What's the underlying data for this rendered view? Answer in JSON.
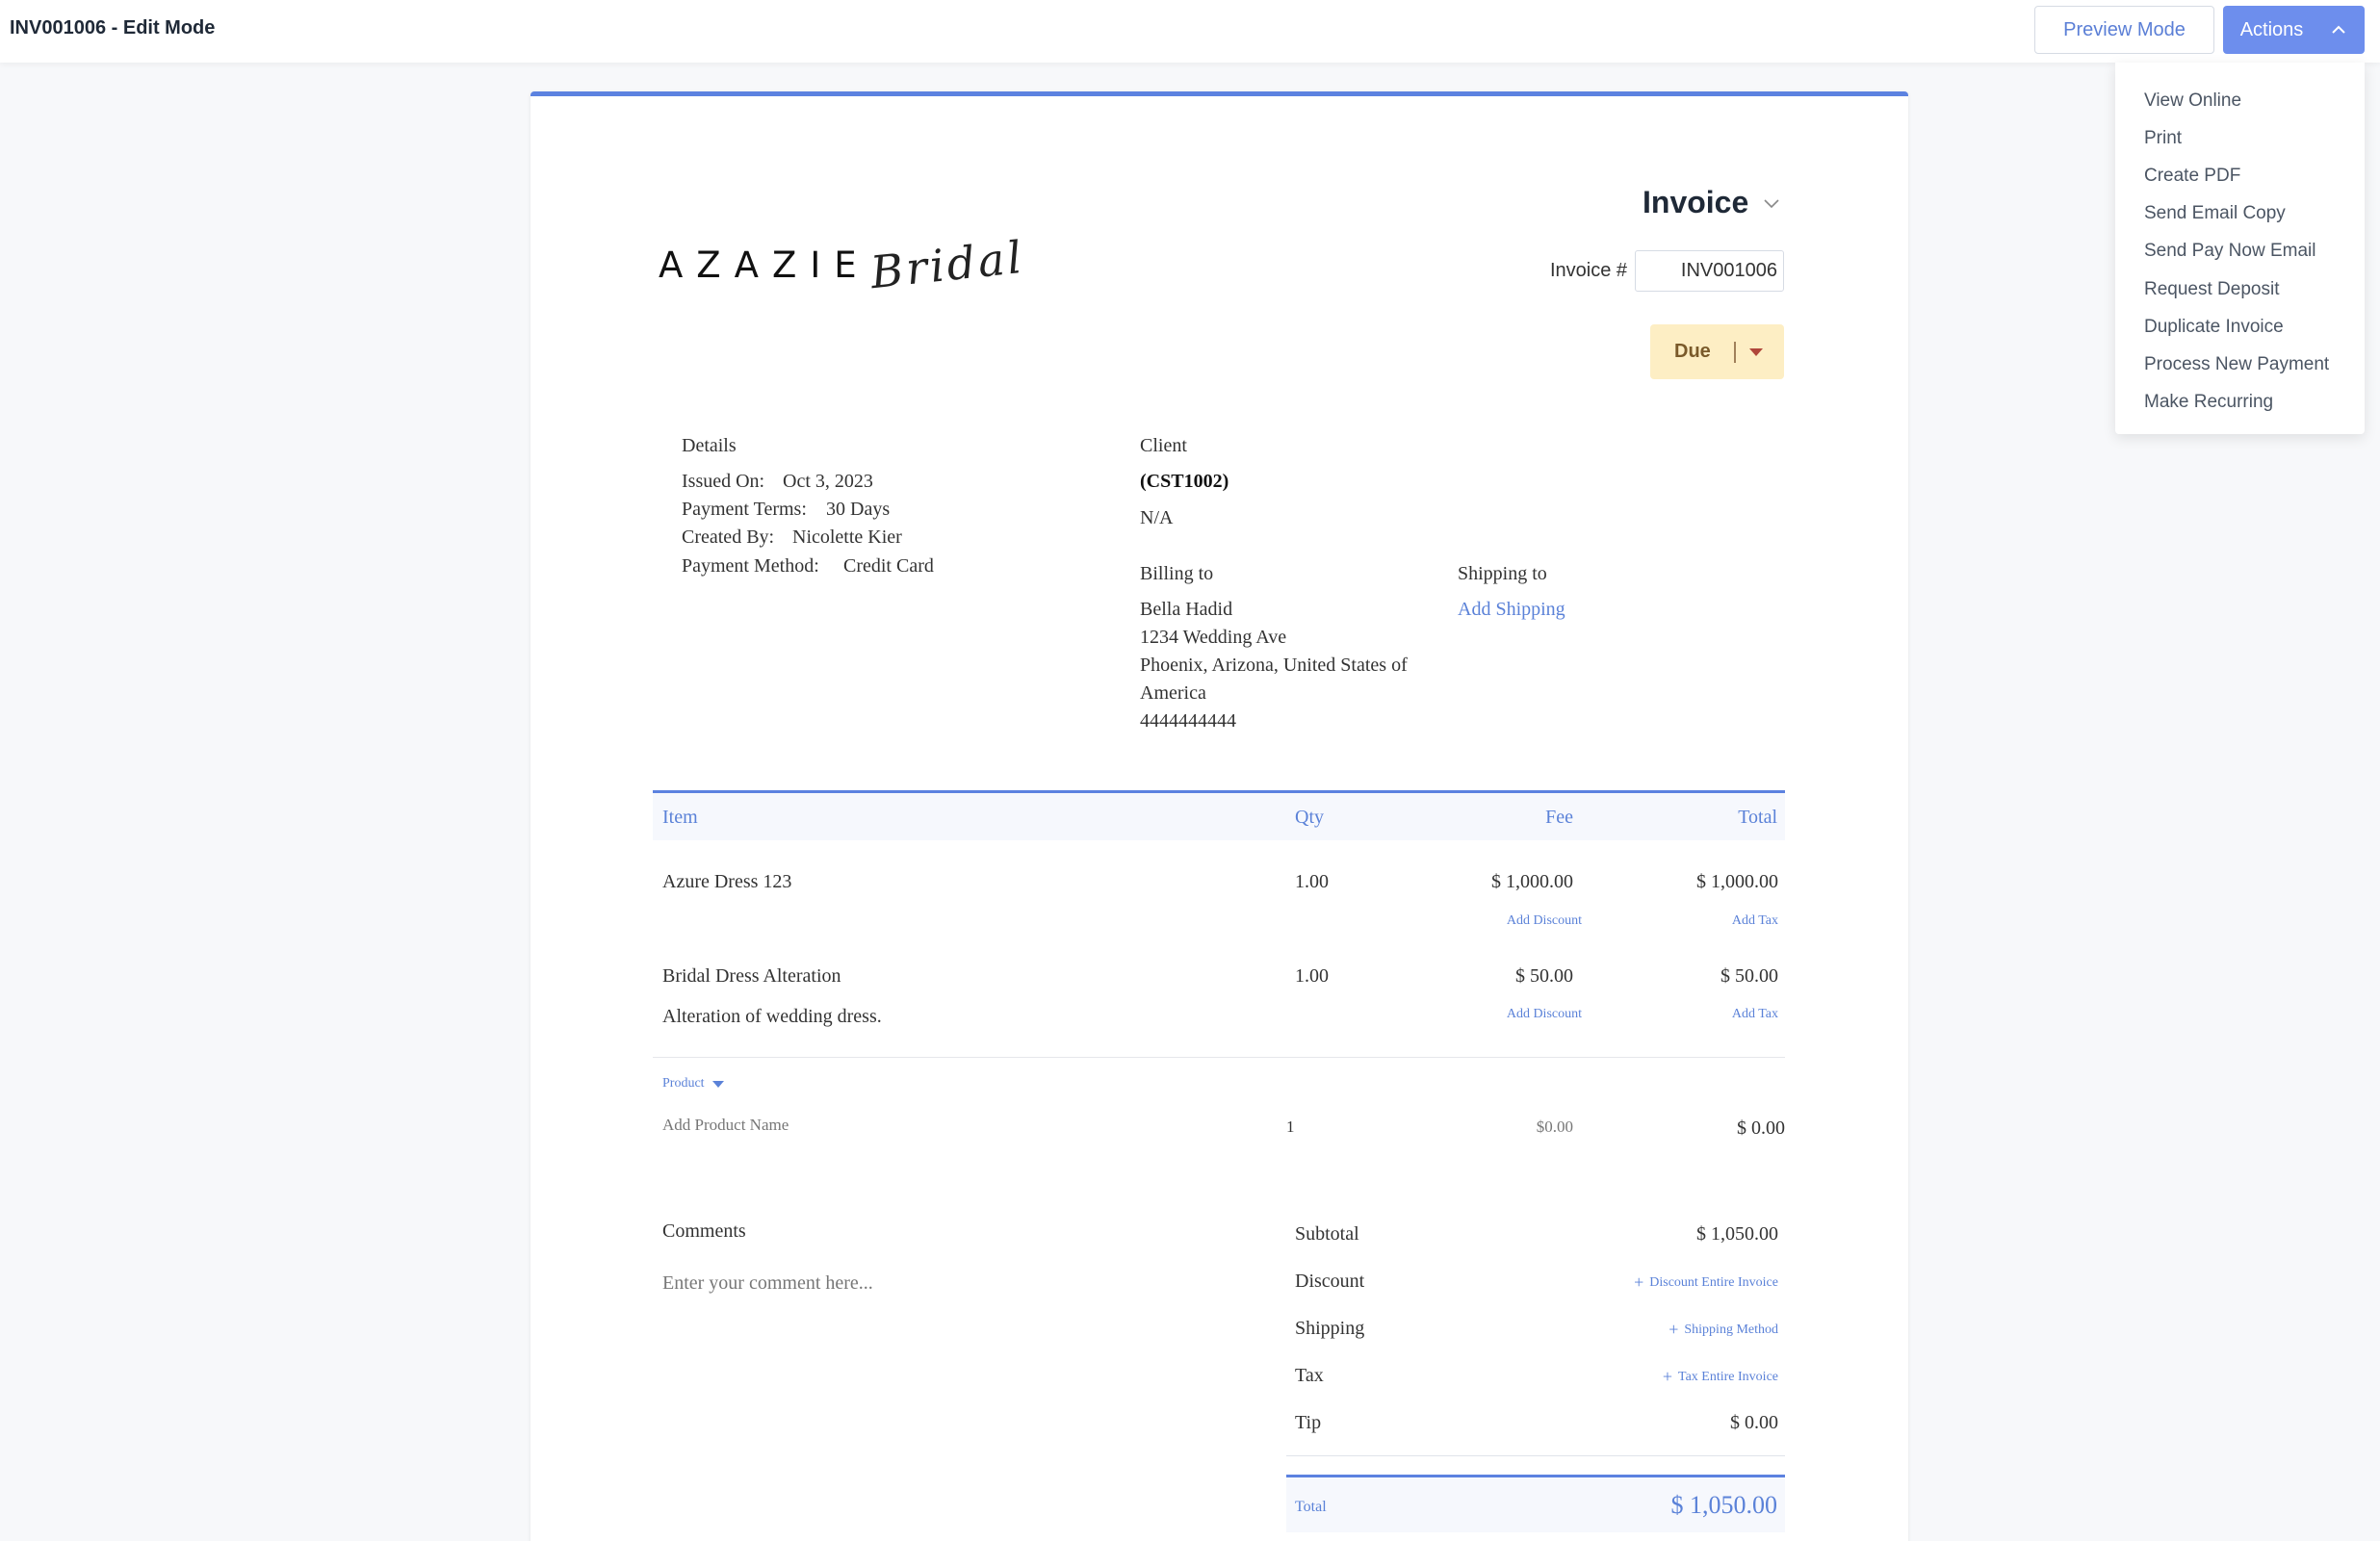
{
  "topbar": {
    "title": "INV001006 - Edit Mode",
    "preview_label": "Preview Mode",
    "actions_label": "Actions"
  },
  "actions_menu": [
    "View Online",
    "Print",
    "Create PDF",
    "Send Email Copy",
    "Send Pay Now Email",
    "Request Deposit",
    "Duplicate Invoice",
    "Process New Payment",
    "Make Recurring"
  ],
  "logo": {
    "word": "AZAZIE",
    "script": "Bridal"
  },
  "invoice": {
    "heading": "Invoice",
    "number_label": "Invoice #",
    "number": "INV001006",
    "status": "Due"
  },
  "details": {
    "heading": "Details",
    "issued_label": "Issued On:",
    "issued": "Oct 3, 2023",
    "terms_label": "Payment Terms:",
    "terms": "30 Days",
    "created_label": "Created By:",
    "created": "Nicolette Kier",
    "method_label": "Payment Method:",
    "method": "Credit Card"
  },
  "client": {
    "heading": "Client",
    "id": "(CST1002)",
    "name": "N/A",
    "billing_heading": "Billing to",
    "billing_name": "Bella Hadid",
    "billing_street": "1234 Wedding Ave",
    "billing_city": "Phoenix, Arizona, United States of",
    "billing_country": "America",
    "billing_phone": "4444444444",
    "shipping_heading": "Shipping to",
    "shipping_link": "Add Shipping"
  },
  "table": {
    "headers": {
      "item": "Item",
      "qty": "Qty",
      "fee": "Fee",
      "total": "Total"
    },
    "rows": [
      {
        "item": "Azure Dress 123",
        "description": "",
        "qty": "1.00",
        "fee": "$ 1,000.00",
        "total": "$ 1,000.00",
        "discount_link": "Add Discount",
        "tax_link": "Add Tax"
      },
      {
        "item": "Bridal Dress Alteration",
        "description": "Alteration of wedding dress.",
        "qty": "1.00",
        "fee": "$ 50.00",
        "total": "$ 50.00",
        "discount_link": "Add Discount",
        "tax_link": "Add Tax"
      }
    ],
    "new_row": {
      "type_label": "Product",
      "name_placeholder": "Add Product Name",
      "qty": "1",
      "fee": "$0.00",
      "total": "$ 0.00"
    }
  },
  "comments": {
    "heading": "Comments",
    "placeholder": "Enter your comment here..."
  },
  "summary": {
    "subtotal_label": "Subtotal",
    "subtotal": "$ 1,050.00",
    "discount_label": "Discount",
    "discount_link": "Discount Entire Invoice",
    "shipping_label": "Shipping",
    "shipping_link": "Shipping Method",
    "tax_label": "Tax",
    "tax_link": "Tax Entire Invoice",
    "tip_label": "Tip",
    "tip": "$ 0.00",
    "total_label": "Total",
    "total": "$ 1,050.00"
  }
}
